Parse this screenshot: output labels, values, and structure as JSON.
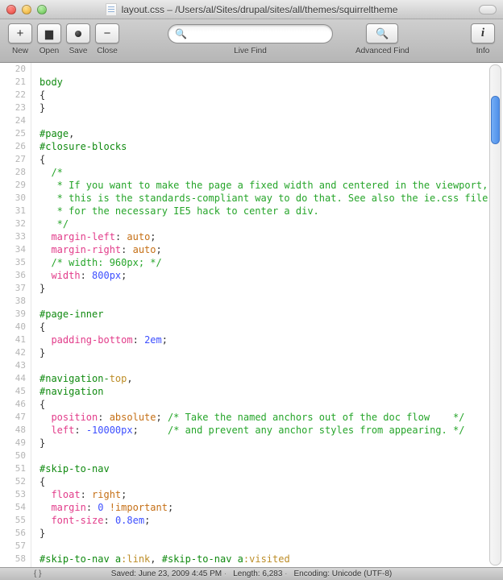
{
  "window": {
    "title": "layout.css – /Users/al/Sites/drupal/sites/all/themes/squirreltheme"
  },
  "toolbar": {
    "new_label": "New",
    "open_label": "Open",
    "save_label": "Save",
    "close_label": "Close",
    "live_find_label": "Live Find",
    "find_placeholder": "",
    "advanced_find_label": "Advanced Find",
    "info_label": "Info"
  },
  "editor": {
    "first_line_number": 20,
    "lines": [
      {
        "t": ""
      },
      {
        "t": "body",
        "cls": "sel"
      },
      {
        "t": "{",
        "cls": "punct"
      },
      {
        "t": "}",
        "cls": "punct"
      },
      {
        "t": ""
      },
      {
        "segments": [
          [
            "#page",
            "sel"
          ],
          [
            ", ",
            "punct"
          ]
        ]
      },
      {
        "t": "#closure-blocks",
        "cls": "sel"
      },
      {
        "t": "{",
        "cls": "punct"
      },
      {
        "t": "  /*",
        "cls": "comment"
      },
      {
        "t": "   * If you want to make the page a fixed width and centered in the viewport,",
        "cls": "comment"
      },
      {
        "t": "   * this is the standards-compliant way to do that. See also the ie.css file",
        "cls": "comment"
      },
      {
        "t": "   * for the necessary IE5 hack to center a div.",
        "cls": "comment"
      },
      {
        "t": "   */",
        "cls": "comment"
      },
      {
        "segments": [
          [
            "  ",
            "punct"
          ],
          [
            "margin-left",
            "prop"
          ],
          [
            ": ",
            "punct"
          ],
          [
            "auto",
            "value"
          ],
          [
            ";",
            "punct"
          ]
        ]
      },
      {
        "segments": [
          [
            "  ",
            "punct"
          ],
          [
            "margin-right",
            "prop"
          ],
          [
            ": ",
            "punct"
          ],
          [
            "auto",
            "value"
          ],
          [
            ";",
            "punct"
          ]
        ]
      },
      {
        "t": "  /* width: 960px; */",
        "cls": "comment"
      },
      {
        "segments": [
          [
            "  ",
            "punct"
          ],
          [
            "width",
            "prop"
          ],
          [
            ": ",
            "punct"
          ],
          [
            "800px",
            "num"
          ],
          [
            ";",
            "punct"
          ]
        ]
      },
      {
        "t": "}",
        "cls": "punct"
      },
      {
        "t": ""
      },
      {
        "t": "#page-inner",
        "cls": "sel"
      },
      {
        "t": "{",
        "cls": "punct"
      },
      {
        "segments": [
          [
            "  ",
            "punct"
          ],
          [
            "padding-bottom",
            "prop"
          ],
          [
            ": ",
            "punct"
          ],
          [
            "2em",
            "num"
          ],
          [
            ";",
            "punct"
          ]
        ]
      },
      {
        "t": "}",
        "cls": "punct"
      },
      {
        "t": ""
      },
      {
        "segments": [
          [
            "#navigation-",
            "sel"
          ],
          [
            "top",
            "pseudo"
          ],
          [
            ", ",
            "punct"
          ]
        ]
      },
      {
        "t": "#navigation",
        "cls": "sel"
      },
      {
        "t": "{",
        "cls": "punct"
      },
      {
        "segments": [
          [
            "  ",
            "punct"
          ],
          [
            "position",
            "prop"
          ],
          [
            ": ",
            "punct"
          ],
          [
            "absolute",
            "value"
          ],
          [
            "; ",
            "punct"
          ],
          [
            "/* Take the named anchors out of the doc flow    */",
            "comment"
          ]
        ]
      },
      {
        "segments": [
          [
            "  ",
            "punct"
          ],
          [
            "left",
            "prop"
          ],
          [
            ": ",
            "punct"
          ],
          [
            "-10000px",
            "num"
          ],
          [
            ";     ",
            "punct"
          ],
          [
            "/* and prevent any anchor styles from appearing. */",
            "comment"
          ]
        ]
      },
      {
        "t": "}",
        "cls": "punct"
      },
      {
        "t": ""
      },
      {
        "t": "#skip-to-nav",
        "cls": "sel"
      },
      {
        "t": "{",
        "cls": "punct"
      },
      {
        "segments": [
          [
            "  ",
            "punct"
          ],
          [
            "float",
            "prop"
          ],
          [
            ": ",
            "punct"
          ],
          [
            "right",
            "value"
          ],
          [
            ";",
            "punct"
          ]
        ]
      },
      {
        "segments": [
          [
            "  ",
            "punct"
          ],
          [
            "margin",
            "prop"
          ],
          [
            ": ",
            "punct"
          ],
          [
            "0",
            "num"
          ],
          [
            " ",
            "punct"
          ],
          [
            "!important",
            "value"
          ],
          [
            ";",
            "punct"
          ]
        ]
      },
      {
        "segments": [
          [
            "  ",
            "punct"
          ],
          [
            "font-size",
            "prop"
          ],
          [
            ": ",
            "punct"
          ],
          [
            "0.8em",
            "num"
          ],
          [
            ";",
            "punct"
          ]
        ]
      },
      {
        "t": "}",
        "cls": "punct"
      },
      {
        "t": ""
      },
      {
        "segments": [
          [
            "#skip-to-nav a",
            "sel"
          ],
          [
            ":link",
            "pseudo"
          ],
          [
            ", ",
            "punct"
          ],
          [
            "#skip-to-nav a",
            "sel"
          ],
          [
            ":visited",
            "pseudo"
          ]
        ]
      }
    ]
  },
  "status": {
    "saved": "Saved: June 23, 2009 4:45 PM",
    "length": "Length: 6,283",
    "encoding": "Encoding: Unicode (UTF-8)"
  }
}
